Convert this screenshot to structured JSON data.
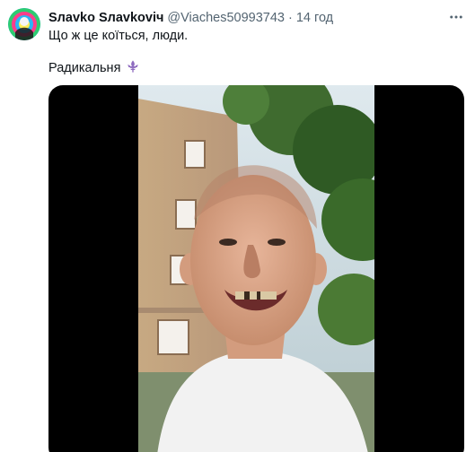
{
  "author": {
    "display_name": "Ѕлavko Ѕлavkoviч",
    "handle": "@Viaches50993743",
    "separator": "·",
    "time": "14 год"
  },
  "tweet": {
    "text_line1": "Що ж це коїться, люди.",
    "text_line2": "Радикальня",
    "emoji_icon": "fleur-de-lis-icon",
    "emoji_color": "#8e6bbf"
  },
  "media": {
    "type": "video",
    "background": "#000000"
  },
  "icons": {
    "more": "more-horizontal-icon",
    "avatar": "avatar-image"
  },
  "colors": {
    "text_primary": "#0f1419",
    "text_secondary": "#536471"
  }
}
